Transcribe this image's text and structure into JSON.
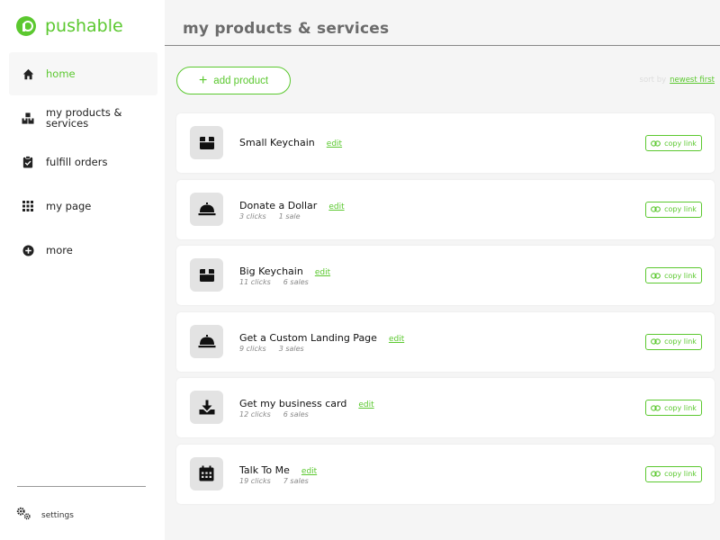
{
  "app": {
    "name": "pushable",
    "brand_color": "#5bc82f"
  },
  "sidebar": {
    "items": [
      {
        "label": "home",
        "icon": "home-icon",
        "active": true
      },
      {
        "label": "my products & services",
        "icon": "boxes-icon",
        "active": false
      },
      {
        "label": "fulfill orders",
        "icon": "clipboard-check-icon",
        "active": false
      },
      {
        "label": "my page",
        "icon": "grid-icon",
        "active": false
      },
      {
        "label": "more",
        "icon": "plus-circle-icon",
        "active": false
      }
    ],
    "settings_label": "settings"
  },
  "main": {
    "title": "my products & services",
    "add_button_label": "add product",
    "sort_label": "sort by",
    "sort_value": "newest first",
    "products": [
      {
        "name": "Small Keychain",
        "edit": "edit",
        "clicks": "",
        "sales": "",
        "icon": "box-icon",
        "copy": "copy link"
      },
      {
        "name": "Donate a Dollar",
        "edit": "edit",
        "clicks": "3 clicks",
        "sales": "1 sale",
        "icon": "bell-icon",
        "copy": "copy link"
      },
      {
        "name": "Big Keychain",
        "edit": "edit",
        "clicks": "11 clicks",
        "sales": "6 sales",
        "icon": "box-icon",
        "copy": "copy link"
      },
      {
        "name": "Get a Custom Landing Page",
        "edit": "edit",
        "clicks": "9 clicks",
        "sales": "3 sales",
        "icon": "bell-icon",
        "copy": "copy link"
      },
      {
        "name": "Get my business card",
        "edit": "edit",
        "clicks": "12 clicks",
        "sales": "6 sales",
        "icon": "download-icon",
        "copy": "copy link"
      },
      {
        "name": "Talk To Me",
        "edit": "edit",
        "clicks": "19 clicks",
        "sales": "7 sales",
        "icon": "calendar-icon",
        "copy": "copy link"
      }
    ]
  }
}
